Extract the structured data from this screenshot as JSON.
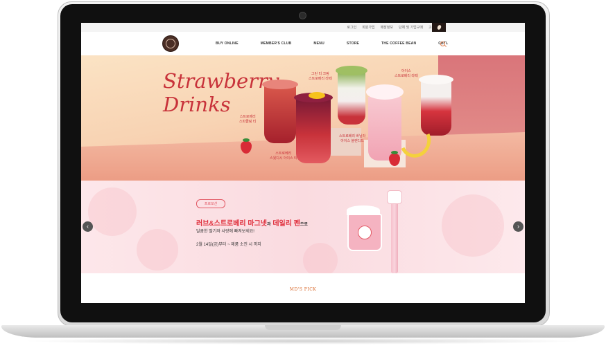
{
  "utility_nav": {
    "links": [
      "로그인",
      "회원가입",
      "매장정보",
      "단체 및 기업구매",
      "고객서비스"
    ]
  },
  "main_nav": {
    "items": [
      "BUY ONLINE",
      "MEMBER'S CLUB",
      "MENU",
      "STORE",
      "THE COFFEE BEAN",
      "CBTL"
    ]
  },
  "hero": {
    "title_line1": "Strawberry",
    "title_line2": "Drinks",
    "drinks": [
      {
        "label": "스트로베리\n스파클링 티"
      },
      {
        "label": "스트로베리\n스윗디시 아이스 티"
      },
      {
        "label": "그린 티 크림\n스트로베리 라떼"
      },
      {
        "label": "스트로베리 바닐라\n아이스 블렌디드"
      },
      {
        "label": "아이스\n스트로베리 라떼"
      }
    ]
  },
  "promo": {
    "badge": "프로모션",
    "title_part1": "러브&스트로베리 마그넷",
    "title_conj": "과",
    "title_part2": "데일리 펜",
    "title_suffix": "으로",
    "subtitle": "달콤한 딸기와 사랑에 빠져보세요!",
    "date": "2월 14일(금)부터 ~ 제품 소진 시 까지"
  },
  "carousel": {
    "prev": "‹",
    "next": "›"
  },
  "section": {
    "title": "MD'S PICK"
  },
  "colors": {
    "accent": "#e0323f",
    "brand": "#231815",
    "section_title": "#d9692c"
  }
}
